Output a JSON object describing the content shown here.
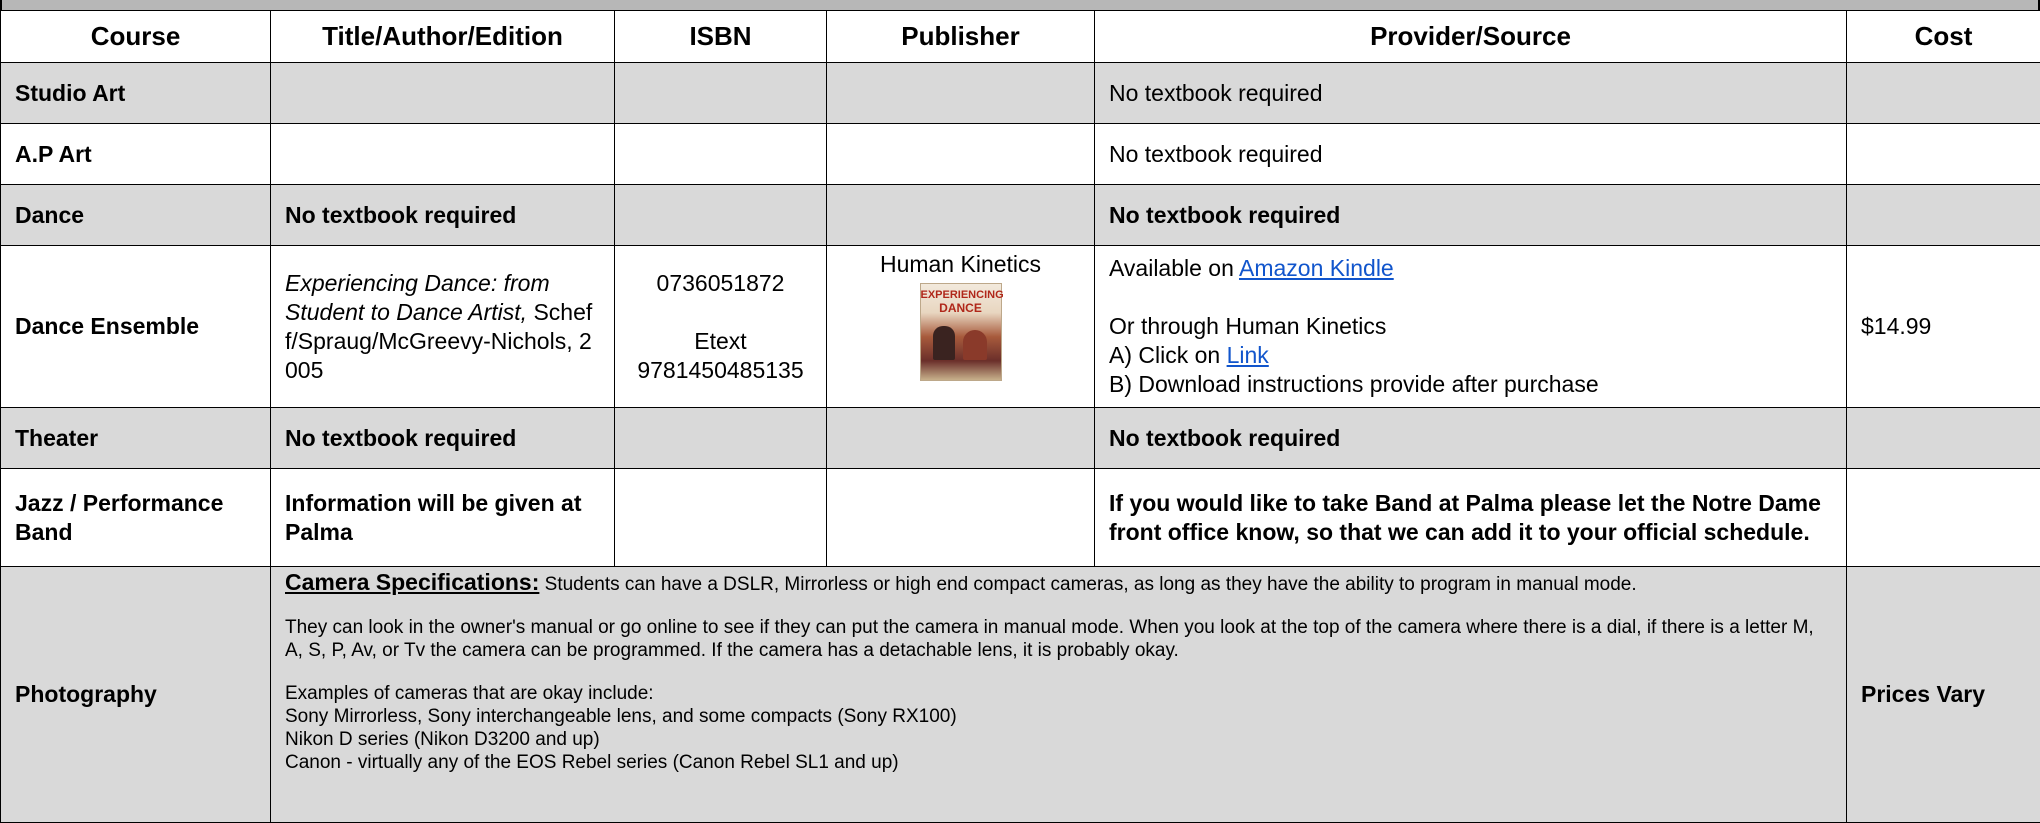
{
  "headers": [
    "Course",
    "Title/Author/Edition",
    "ISBN",
    "Publisher",
    "Provider/Source",
    "Cost"
  ],
  "rows": {
    "studio_art": {
      "course": "Studio Art",
      "provider": "No textbook required"
    },
    "ap_art": {
      "course": "A.P Art",
      "provider": "No textbook required"
    },
    "dance": {
      "course": "Dance",
      "title": "No textbook required",
      "provider": "No textbook required"
    },
    "dance_ensemble": {
      "course": "Dance Ensemble",
      "title_italic": "Experiencing Dance: from Student to Dance Artist,",
      "title_rest": "Scheff/Spraug/McGreevy-Nichols, 2005",
      "isbn": "0736051872",
      "isbn_etext_label": "Etext",
      "isbn_etext": "9781450485135",
      "publisher": "Human Kinetics",
      "cover_line1": "EXPERIENCING",
      "cover_line2": "DANCE",
      "provider_available": "Available on ",
      "provider_amazon_link": "Amazon Kindle",
      "provider_or": "Or through Human Kinetics",
      "provider_a": "A) Click on ",
      "provider_link": "Link",
      "provider_b": "B) Download instructions provide after purchase",
      "cost": "$14.99"
    },
    "theater": {
      "course": "Theater",
      "title": "No textbook required",
      "provider": "No textbook required"
    },
    "jazz_band": {
      "course": "Jazz / Performance Band",
      "title": "Information will be given at Palma",
      "provider": "If you would like to take Band at Palma please let the Notre Dame front office know, so that we can add it to your official schedule."
    },
    "photography": {
      "course": "Photography",
      "spec_heading": "Camera Specifications:",
      "spec_intro": " Students can have a DSLR, Mirrorless or high end compact cameras, as long as they have the ability to program in manual mode.",
      "spec_para2": "They can look in the owner's manual or go online to see if they can put the camera in manual mode.  When you look at the top of the camera where there is a dial, if there is a letter M, A, S, P, Av, or Tv the camera can be programmed.  If the camera has a detachable lens, it is probably okay.",
      "examples_heading": "Examples of cameras that are okay include:",
      "example_1": "Sony Mirrorless,  Sony interchangeable lens, and some compacts  (Sony RX100)",
      "example_2": "Nikon D series  (Nikon D3200 and up)",
      "example_3": "Canon - virtually any of the EOS Rebel series (Canon Rebel SL1 and up)",
      "cost": "Prices Vary"
    }
  },
  "colors": {
    "gray_row": "#d9d9d9",
    "link": "#1155cc"
  }
}
